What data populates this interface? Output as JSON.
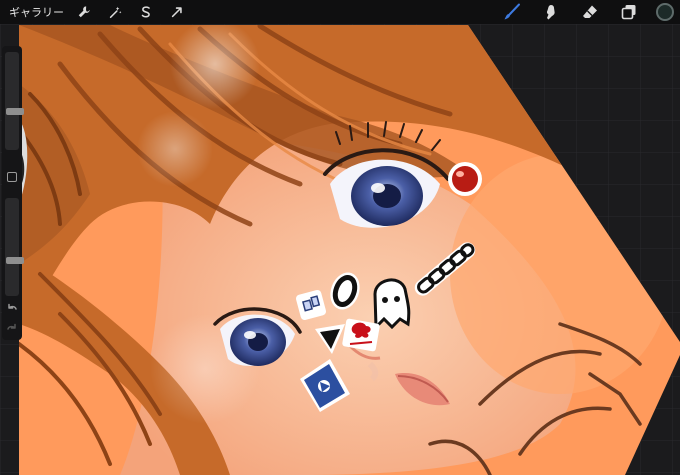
{
  "toolbar": {
    "gallery_label": "ギャラリー",
    "left_tools": [
      {
        "name": "actions-icon"
      },
      {
        "name": "adjustments-icon"
      },
      {
        "name": "selection-icon"
      },
      {
        "name": "transform-icon"
      }
    ],
    "right_tools": [
      {
        "name": "brush-icon",
        "active": true
      },
      {
        "name": "smudge-icon",
        "active": false
      },
      {
        "name": "eraser-icon",
        "active": false
      },
      {
        "name": "layers-icon",
        "active": false
      }
    ],
    "current_color": "#1c2a28"
  },
  "sidebar": {
    "brush_size": 0.38,
    "brush_opacity": 0.35
  },
  "colors": {
    "accent_blue": "#3d7ae0",
    "canvas_bg": "#ff9a5c",
    "hair": "#c66a2a",
    "skin": "#f6b08a"
  }
}
